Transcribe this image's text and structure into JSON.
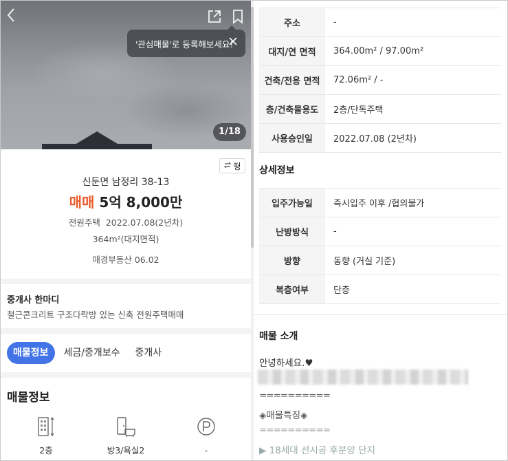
{
  "gallery": {
    "counter": "1/18",
    "tooltip": "'관심매물'로 등록해보세요!"
  },
  "unit_toggle_label": "평",
  "listing": {
    "address": "신둔면 남정리 38-13",
    "deal_type": "매매",
    "price": "5억 8,000만",
    "house_type": "전원주택",
    "reg_date": "2022.07.08(2년차)",
    "area": "364m²(대지면적)",
    "agent_date": "매경부동산 06.02"
  },
  "remark": {
    "title": "중개사 한마디",
    "text": "철근콘크리트 구조다락방 있는 신축 전원주택매매"
  },
  "tabs": [
    {
      "label": "매물정보",
      "active": true
    },
    {
      "label": "세금/중개보수",
      "active": false
    },
    {
      "label": "중개사",
      "active": false
    }
  ],
  "info_section": {
    "title": "매물정보",
    "features": [
      {
        "icon": "building-floors-icon",
        "label": "2층"
      },
      {
        "icon": "room-bath-icon",
        "label": "방3/욕실2"
      },
      {
        "icon": "parking-icon",
        "label": "-"
      }
    ]
  },
  "basic_table": [
    {
      "key": "주소",
      "value": "-"
    },
    {
      "key": "대지/연 면적",
      "value": "364.00m² / 97.00m²"
    },
    {
      "key": "건축/전용 면적",
      "value": "72.06m² / -"
    },
    {
      "key": "층/건축물용도",
      "value": "2층/단독주택"
    },
    {
      "key": "사용승인일",
      "value": "2022.07.08 (2년차)"
    }
  ],
  "detail_section": {
    "title": "상세정보",
    "rows": [
      {
        "key": "입주가능일",
        "value": "즉시입주 이후 /협의불가"
      },
      {
        "key": "난방방식",
        "value": "-"
      },
      {
        "key": "방향",
        "value": "동향 (거실 기준)"
      },
      {
        "key": "복층여부",
        "value": "단층"
      }
    ]
  },
  "intro_section": {
    "title": "매물 소개",
    "greeting": "안녕하세요.♥",
    "line_sep1": "==========",
    "feature_heading": "◈매물특징◈",
    "line_sep2": "==========",
    "bullet1": "▶ 18세대 선시공 후분양 단지"
  }
}
